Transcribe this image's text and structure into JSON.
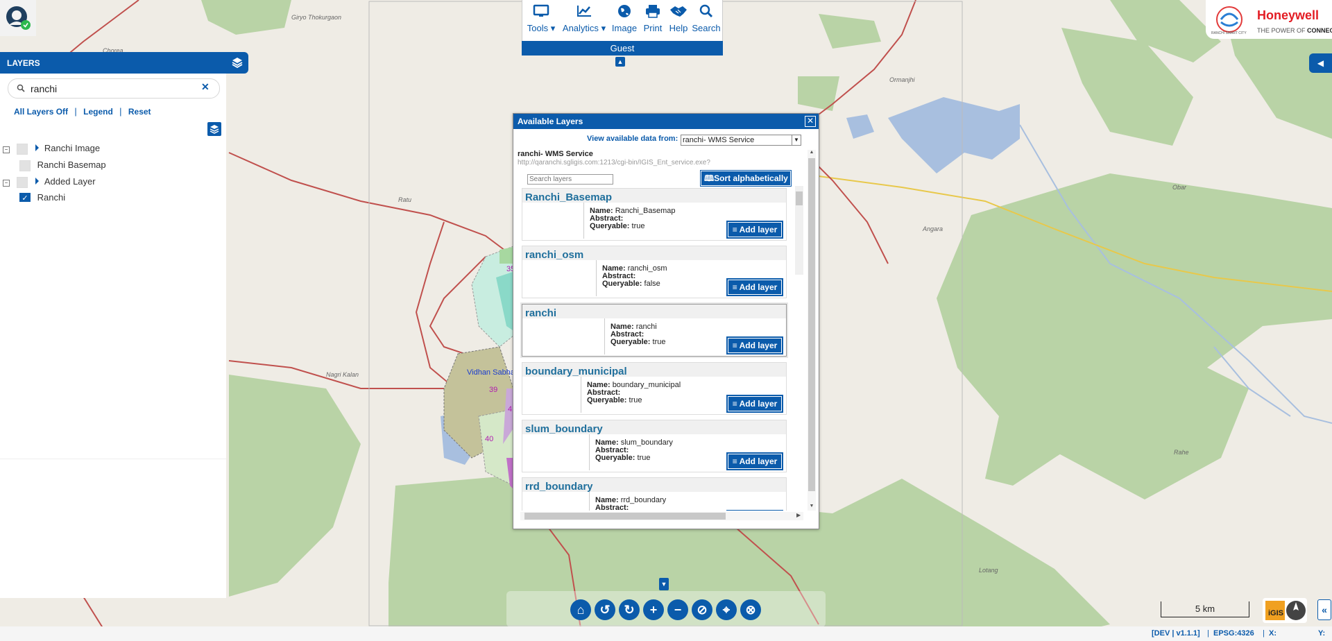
{
  "map_labels": {
    "village_1": "Giryo Thokurgaon",
    "village_2": "Chorea",
    "village_3": "Ormanjhi",
    "village_4": "Ratu",
    "village_5": "Angara",
    "village_6": "Obar",
    "village_7": "Nagri Kalan",
    "village_8": "Rahe",
    "village_9": "Lotang",
    "vidhan_sabha": "Vidhan Sabha",
    "ward_35": "35",
    "ward_39": "39",
    "ward_40": "40",
    "ward_4x": "4"
  },
  "toolbar": {
    "tools": "Tools",
    "analytics": "Analytics",
    "image": "Image",
    "print": "Print",
    "help": "Help",
    "search": "Search",
    "guest": "Guest"
  },
  "brand": {
    "city_logo_text": "RANCHI SMART CITY",
    "company": "Honeywell",
    "tagline_1": "THE POWER OF",
    "tagline_2": "CONNECTED"
  },
  "layers_panel": {
    "title": "LAYERS",
    "search_value": "ranchi",
    "all_layers_off": "All Layers Off",
    "legend": "Legend",
    "reset": "Reset",
    "separator": "|",
    "tree": [
      {
        "label": "Ranchi Image",
        "checked": false
      },
      {
        "label": "Ranchi Basemap",
        "checked": false
      },
      {
        "label": "Added Layer",
        "checked": false
      },
      {
        "label": "Ranchi",
        "checked": true
      }
    ]
  },
  "dialog": {
    "title": "Available Layers",
    "view_label": "View available data from:",
    "source_selected": "ranchi- WMS Service",
    "service_name": "ranchi- WMS Service",
    "service_url": "http://qaranchi.sgligis.com:1213/cgi-bin/IGIS_Ent_service.exe?",
    "search_placeholder": "Search layers",
    "sort_label": "Sort alphabetically",
    "name_key": "Name:",
    "abstract_key": "Abstract:",
    "queryable_key": "Queryable:",
    "add_label": "Add layer",
    "layers": [
      {
        "title": "Ranchi_Basemap",
        "name": "Ranchi_Basemap",
        "queryable": "true"
      },
      {
        "title": "ranchi_osm",
        "name": "ranchi_osm",
        "queryable": "false"
      },
      {
        "title": "ranchi",
        "name": "ranchi",
        "queryable": "true"
      },
      {
        "title": "boundary_municipal",
        "name": "boundary_municipal",
        "queryable": "true"
      },
      {
        "title": "slum_boundary",
        "name": "slum_boundary",
        "queryable": "true"
      },
      {
        "title": "rrd_boundary",
        "name": "rrd_boundary",
        "queryable": ""
      }
    ]
  },
  "scale": "5 km",
  "footer": {
    "version": "[DEV | v1.1.1]",
    "epsg": "EPSG:4326",
    "x_label": "X:",
    "y_label": "Y:"
  },
  "colors": {
    "primary": "#0b5bab",
    "forest": "#b9d3a6",
    "water": "#a8bfdf",
    "road_major": "#c0504d",
    "road_secondary": "#e8c84a"
  }
}
